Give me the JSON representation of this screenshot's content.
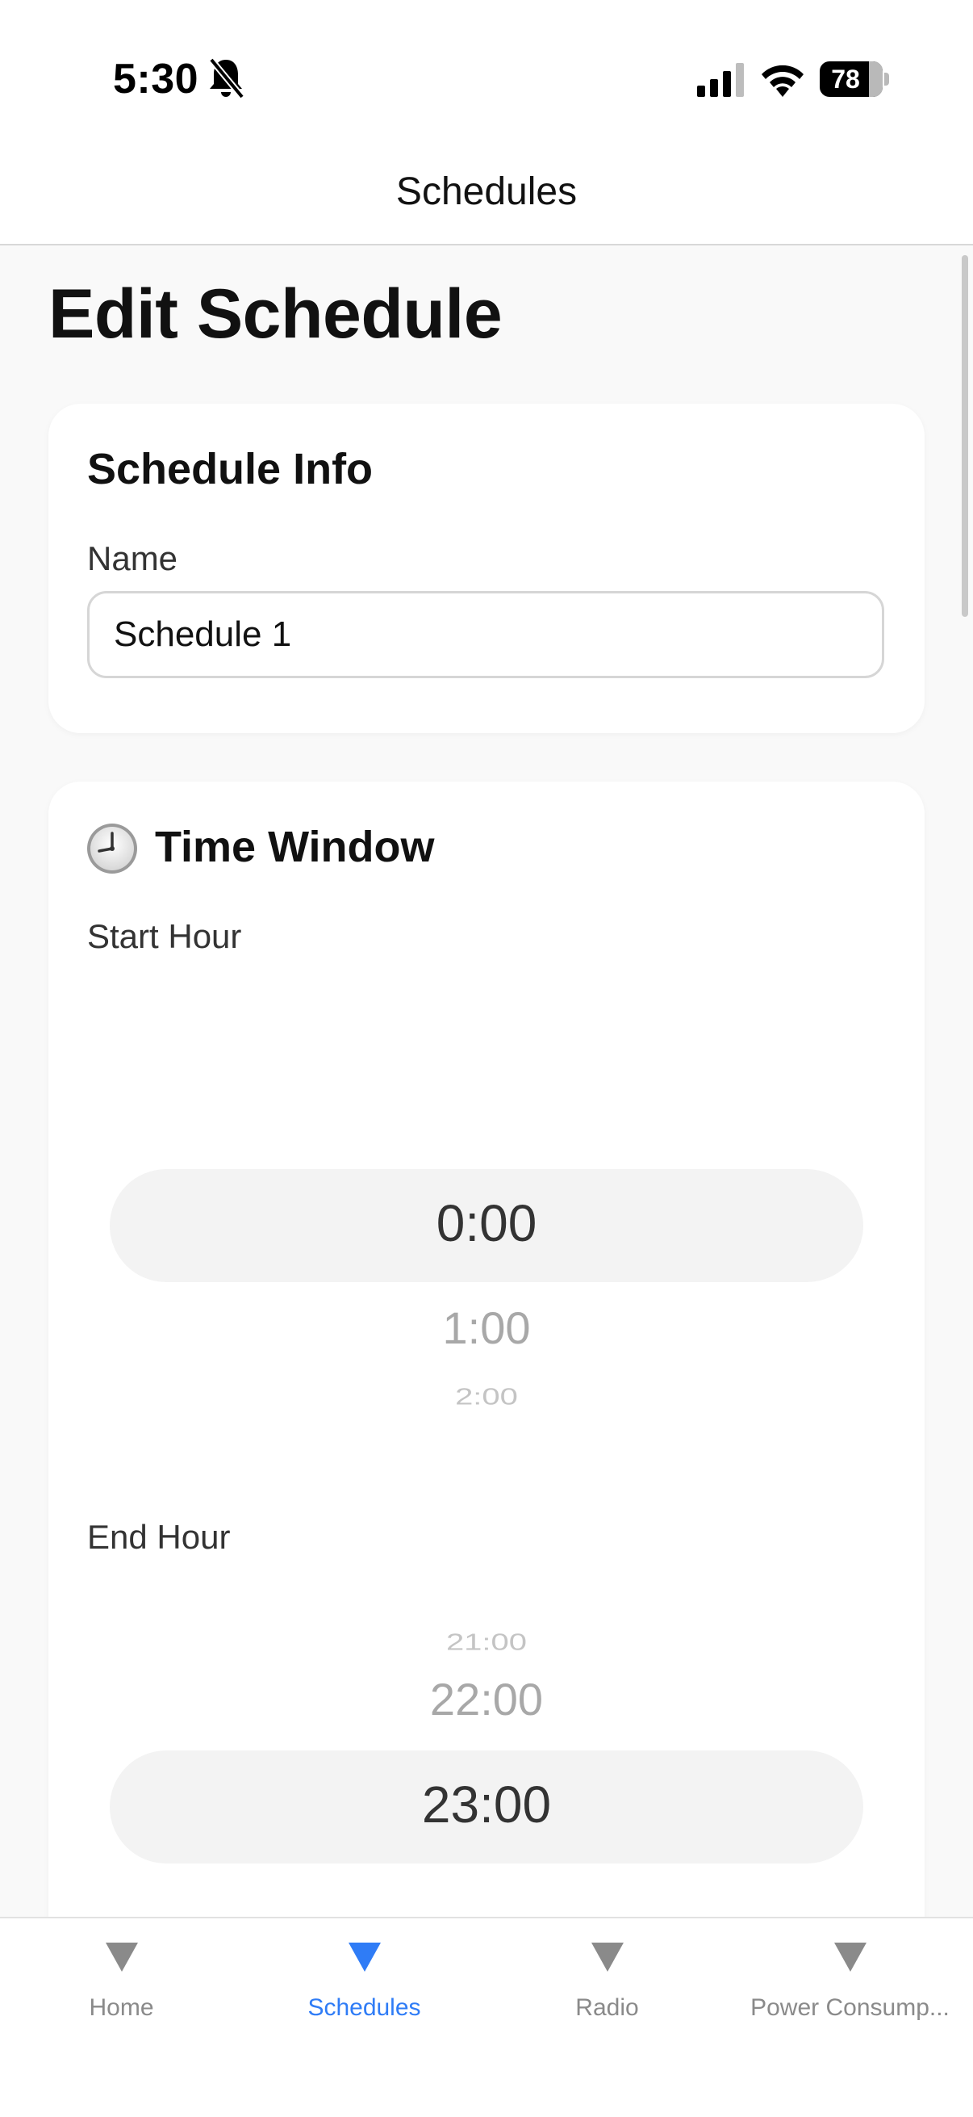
{
  "status_bar": {
    "time": "5:30",
    "battery_percent": 78,
    "battery_label": "78"
  },
  "nav": {
    "title": "Schedules"
  },
  "page": {
    "title": "Edit Schedule"
  },
  "schedule_info": {
    "heading": "Schedule Info",
    "name_label": "Name",
    "name_value": "Schedule 1"
  },
  "time_window": {
    "heading": "Time Window",
    "icon": "clock-icon",
    "start_label": "Start Hour",
    "start_selected": "0:00",
    "start_next_1": "1:00",
    "start_next_2": "2:00",
    "end_label": "End Hour",
    "end_prev_2": "21:00",
    "end_prev_1": "22:00",
    "end_selected": "23:00"
  },
  "tab_bar": {
    "tabs": [
      {
        "label": "Home",
        "icon": "triangle-down-icon",
        "active": false
      },
      {
        "label": "Schedules",
        "icon": "triangle-down-icon",
        "active": true
      },
      {
        "label": "Radio",
        "icon": "triangle-down-icon",
        "active": false
      },
      {
        "label": "Power Consump...",
        "icon": "triangle-down-icon",
        "active": false
      }
    ]
  },
  "colors": {
    "accent": "#2f7cf6",
    "tab_inactive": "#8a8a8a",
    "background": "#f9f9f9",
    "card": "#ffffff"
  }
}
